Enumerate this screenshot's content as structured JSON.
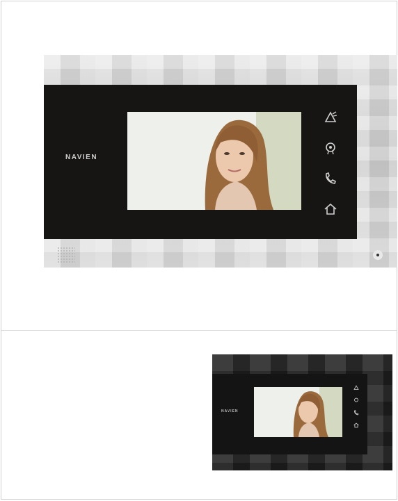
{
  "brand": "NAVIEN",
  "products": [
    {
      "variant": "silver",
      "buttons": [
        {
          "icon": "doorbell-icon",
          "name": "call"
        },
        {
          "icon": "camera-icon",
          "name": "monitor"
        },
        {
          "icon": "phone-icon",
          "name": "talk"
        },
        {
          "icon": "home-icon",
          "name": "home"
        }
      ]
    },
    {
      "variant": "black",
      "buttons": [
        {
          "icon": "doorbell-icon",
          "name": "call"
        },
        {
          "icon": "camera-icon",
          "name": "monitor"
        },
        {
          "icon": "phone-icon",
          "name": "talk"
        },
        {
          "icon": "home-icon",
          "name": "home"
        }
      ]
    }
  ]
}
